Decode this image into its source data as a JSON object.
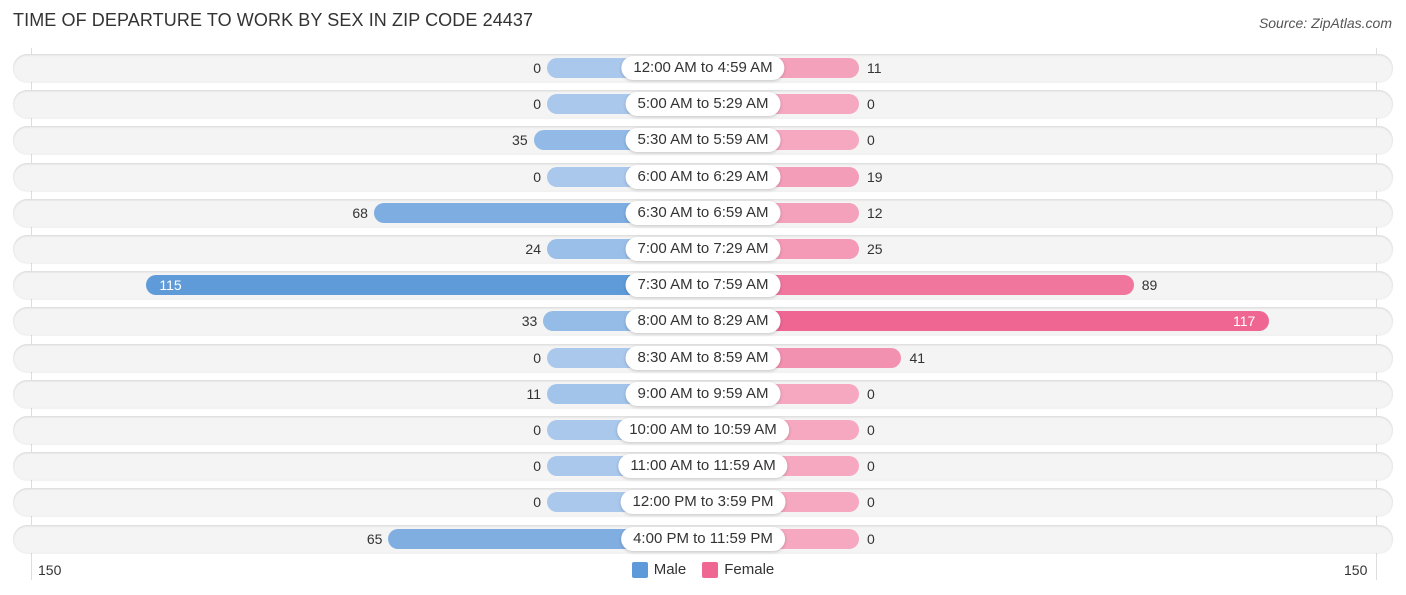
{
  "header": {
    "title": "TIME OF DEPARTURE TO WORK BY SEX IN ZIP CODE 24437",
    "source": "Source: ZipAtlas.com"
  },
  "colors": {
    "male_light": "#aac8ec",
    "male_dark": "#5e9ad9",
    "female_light": "#f5a8c0",
    "female_dark": "#ef6693"
  },
  "chart_data": {
    "type": "bar",
    "orientation": "horizontal-diverging",
    "title": "TIME OF DEPARTURE TO WORK BY SEX IN ZIP CODE 24437",
    "categories": [
      "12:00 AM to 4:59 AM",
      "5:00 AM to 5:29 AM",
      "5:30 AM to 5:59 AM",
      "6:00 AM to 6:29 AM",
      "6:30 AM to 6:59 AM",
      "7:00 AM to 7:29 AM",
      "7:30 AM to 7:59 AM",
      "8:00 AM to 8:29 AM",
      "8:30 AM to 8:59 AM",
      "9:00 AM to 9:59 AM",
      "10:00 AM to 10:59 AM",
      "11:00 AM to 11:59 AM",
      "12:00 PM to 3:59 PM",
      "4:00 PM to 11:59 PM"
    ],
    "series": [
      {
        "name": "Male",
        "side": "left",
        "values": [
          0,
          0,
          35,
          0,
          68,
          24,
          115,
          33,
          0,
          11,
          0,
          0,
          0,
          65
        ]
      },
      {
        "name": "Female",
        "side": "right",
        "values": [
          11,
          0,
          0,
          19,
          12,
          25,
          89,
          117,
          41,
          0,
          0,
          0,
          0,
          0
        ]
      }
    ],
    "axis": {
      "left_tick": "150",
      "right_tick": "150",
      "range": [
        -150,
        150
      ]
    },
    "legend": {
      "placement": "bottom-center",
      "entries": [
        "Male",
        "Female"
      ]
    },
    "grid": false
  }
}
